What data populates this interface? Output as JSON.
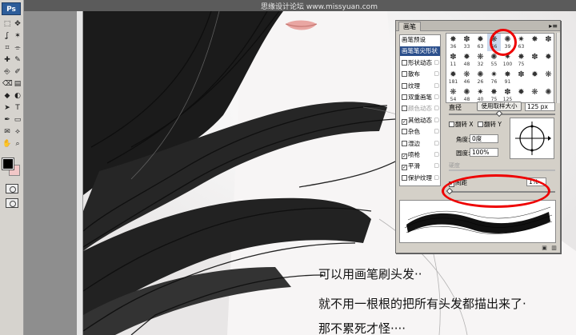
{
  "app": {
    "logo": "Ps",
    "title_watermark": "思缘设计论坛  www.missyuan.com"
  },
  "tools": [
    "marquee-icon",
    "move-icon",
    "lasso-icon",
    "magic-wand-icon",
    "crop-icon",
    "slice-icon",
    "healing-icon",
    "brush-icon",
    "stamp-icon",
    "history-brush-icon",
    "eraser-icon",
    "gradient-icon",
    "blur-icon",
    "dodge-icon",
    "path-select-icon",
    "type-icon",
    "pen-icon",
    "shape-icon",
    "notes-icon",
    "eyedropper-icon",
    "hand-icon",
    "zoom-icon"
  ],
  "colors": {
    "foreground": "#000000",
    "background": "#f1c7c7",
    "highlight": "#e00000"
  },
  "brush_panel": {
    "tab": "画笔",
    "menu": "▸≡",
    "options": [
      {
        "label": "画笔预设",
        "check": "none",
        "lock": false,
        "state": "normal"
      },
      {
        "label": "画笔笔尖形状",
        "check": "none",
        "lock": false,
        "state": "selected"
      },
      {
        "label": "形状动态",
        "check": "off",
        "lock": true,
        "state": "normal"
      },
      {
        "label": "散布",
        "check": "off",
        "lock": true,
        "state": "normal"
      },
      {
        "label": "纹理",
        "check": "off",
        "lock": true,
        "state": "normal"
      },
      {
        "label": "双重画笔",
        "check": "off",
        "lock": true,
        "state": "normal"
      },
      {
        "label": "颜色动态",
        "check": "off",
        "lock": true,
        "state": "dim"
      },
      {
        "label": "其他动态",
        "check": "on",
        "lock": true,
        "state": "normal"
      },
      {
        "label": "杂色",
        "check": "off",
        "lock": true,
        "state": "normal"
      },
      {
        "label": "湿边",
        "check": "off",
        "lock": true,
        "state": "normal"
      },
      {
        "label": "喷枪",
        "check": "on",
        "lock": true,
        "state": "normal"
      },
      {
        "label": "平滑",
        "check": "on",
        "lock": true,
        "state": "normal"
      },
      {
        "label": "保护纹理",
        "check": "off",
        "lock": true,
        "state": "normal"
      }
    ],
    "check_mark": "✓",
    "lock_glyph": "🔒",
    "brush_tips": [
      {
        "size": "36",
        "active": false
      },
      {
        "size": "33",
        "active": false
      },
      {
        "size": "63",
        "active": false
      },
      {
        "size": "66",
        "active": true
      },
      {
        "size": "39",
        "active": false
      },
      {
        "size": "63",
        "active": false
      },
      {
        "size": "",
        "active": false
      },
      {
        "size": "",
        "active": false
      },
      {
        "size": "11",
        "active": false
      },
      {
        "size": "48",
        "active": false
      },
      {
        "size": "32",
        "active": false
      },
      {
        "size": "55",
        "active": false
      },
      {
        "size": "100",
        "active": false
      },
      {
        "size": "75",
        "active": false
      },
      {
        "size": "",
        "active": false
      },
      {
        "size": "",
        "active": false
      },
      {
        "size": "181",
        "active": false
      },
      {
        "size": "46",
        "active": false
      },
      {
        "size": "26",
        "active": false
      },
      {
        "size": "76",
        "active": false
      },
      {
        "size": "91",
        "active": false
      },
      {
        "size": "",
        "active": false
      },
      {
        "size": "",
        "active": false
      },
      {
        "size": "",
        "active": false
      },
      {
        "size": "54",
        "active": false
      },
      {
        "size": "48",
        "active": false
      },
      {
        "size": "40",
        "active": false
      },
      {
        "size": "75",
        "active": false
      },
      {
        "size": "125",
        "active": false
      },
      {
        "size": "",
        "active": false
      },
      {
        "size": "",
        "active": false
      },
      {
        "size": "",
        "active": false
      }
    ],
    "diameter_label": "直径",
    "use_sample_button": "使用取样大小",
    "diameter_value": "125 px",
    "flip_x_label": "翻转 X",
    "flip_y_label": "翻转 Y",
    "angle_label": "角度:",
    "angle_value": "0度",
    "roundness_label": "圆度:",
    "roundness_value": "100%",
    "hardness_label": "硬度",
    "spacing_label": "间距",
    "spacing_checked": "✓",
    "spacing_value": "1%",
    "footer_icons": [
      "new-brush-icon",
      "delete-brush-icon"
    ]
  },
  "captions": {
    "line1": "可以用画笔刷头发··",
    "line2": "就不用一根根的把所有头发都描出来了·",
    "line3": "那不累死才怪····"
  }
}
